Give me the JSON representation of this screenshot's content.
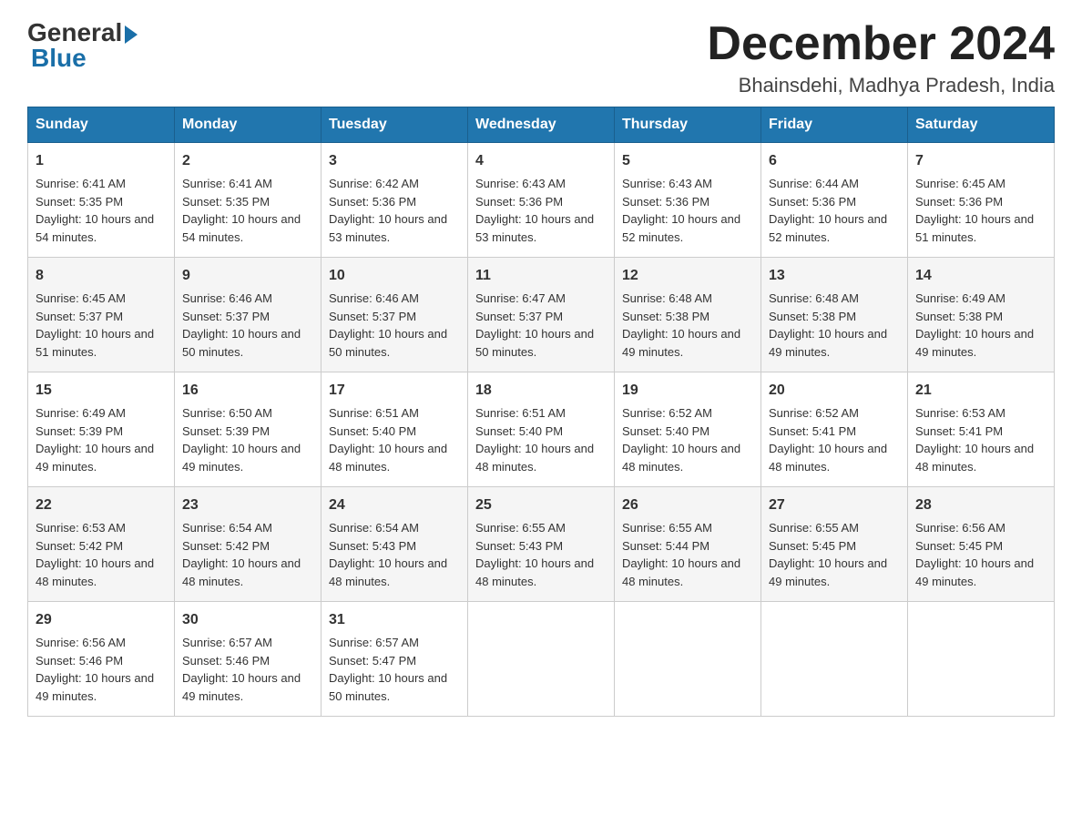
{
  "logo": {
    "general": "General",
    "blue": "Blue"
  },
  "title": "December 2024",
  "location": "Bhainsdehi, Madhya Pradesh, India",
  "headers": [
    "Sunday",
    "Monday",
    "Tuesday",
    "Wednesday",
    "Thursday",
    "Friday",
    "Saturday"
  ],
  "weeks": [
    [
      {
        "day": "1",
        "sunrise": "6:41 AM",
        "sunset": "5:35 PM",
        "daylight": "10 hours and 54 minutes."
      },
      {
        "day": "2",
        "sunrise": "6:41 AM",
        "sunset": "5:35 PM",
        "daylight": "10 hours and 54 minutes."
      },
      {
        "day": "3",
        "sunrise": "6:42 AM",
        "sunset": "5:36 PM",
        "daylight": "10 hours and 53 minutes."
      },
      {
        "day": "4",
        "sunrise": "6:43 AM",
        "sunset": "5:36 PM",
        "daylight": "10 hours and 53 minutes."
      },
      {
        "day": "5",
        "sunrise": "6:43 AM",
        "sunset": "5:36 PM",
        "daylight": "10 hours and 52 minutes."
      },
      {
        "day": "6",
        "sunrise": "6:44 AM",
        "sunset": "5:36 PM",
        "daylight": "10 hours and 52 minutes."
      },
      {
        "day": "7",
        "sunrise": "6:45 AM",
        "sunset": "5:36 PM",
        "daylight": "10 hours and 51 minutes."
      }
    ],
    [
      {
        "day": "8",
        "sunrise": "6:45 AM",
        "sunset": "5:37 PM",
        "daylight": "10 hours and 51 minutes."
      },
      {
        "day": "9",
        "sunrise": "6:46 AM",
        "sunset": "5:37 PM",
        "daylight": "10 hours and 50 minutes."
      },
      {
        "day": "10",
        "sunrise": "6:46 AM",
        "sunset": "5:37 PM",
        "daylight": "10 hours and 50 minutes."
      },
      {
        "day": "11",
        "sunrise": "6:47 AM",
        "sunset": "5:37 PM",
        "daylight": "10 hours and 50 minutes."
      },
      {
        "day": "12",
        "sunrise": "6:48 AM",
        "sunset": "5:38 PM",
        "daylight": "10 hours and 49 minutes."
      },
      {
        "day": "13",
        "sunrise": "6:48 AM",
        "sunset": "5:38 PM",
        "daylight": "10 hours and 49 minutes."
      },
      {
        "day": "14",
        "sunrise": "6:49 AM",
        "sunset": "5:38 PM",
        "daylight": "10 hours and 49 minutes."
      }
    ],
    [
      {
        "day": "15",
        "sunrise": "6:49 AM",
        "sunset": "5:39 PM",
        "daylight": "10 hours and 49 minutes."
      },
      {
        "day": "16",
        "sunrise": "6:50 AM",
        "sunset": "5:39 PM",
        "daylight": "10 hours and 49 minutes."
      },
      {
        "day": "17",
        "sunrise": "6:51 AM",
        "sunset": "5:40 PM",
        "daylight": "10 hours and 48 minutes."
      },
      {
        "day": "18",
        "sunrise": "6:51 AM",
        "sunset": "5:40 PM",
        "daylight": "10 hours and 48 minutes."
      },
      {
        "day": "19",
        "sunrise": "6:52 AM",
        "sunset": "5:40 PM",
        "daylight": "10 hours and 48 minutes."
      },
      {
        "day": "20",
        "sunrise": "6:52 AM",
        "sunset": "5:41 PM",
        "daylight": "10 hours and 48 minutes."
      },
      {
        "day": "21",
        "sunrise": "6:53 AM",
        "sunset": "5:41 PM",
        "daylight": "10 hours and 48 minutes."
      }
    ],
    [
      {
        "day": "22",
        "sunrise": "6:53 AM",
        "sunset": "5:42 PM",
        "daylight": "10 hours and 48 minutes."
      },
      {
        "day": "23",
        "sunrise": "6:54 AM",
        "sunset": "5:42 PM",
        "daylight": "10 hours and 48 minutes."
      },
      {
        "day": "24",
        "sunrise": "6:54 AM",
        "sunset": "5:43 PM",
        "daylight": "10 hours and 48 minutes."
      },
      {
        "day": "25",
        "sunrise": "6:55 AM",
        "sunset": "5:43 PM",
        "daylight": "10 hours and 48 minutes."
      },
      {
        "day": "26",
        "sunrise": "6:55 AM",
        "sunset": "5:44 PM",
        "daylight": "10 hours and 48 minutes."
      },
      {
        "day": "27",
        "sunrise": "6:55 AM",
        "sunset": "5:45 PM",
        "daylight": "10 hours and 49 minutes."
      },
      {
        "day": "28",
        "sunrise": "6:56 AM",
        "sunset": "5:45 PM",
        "daylight": "10 hours and 49 minutes."
      }
    ],
    [
      {
        "day": "29",
        "sunrise": "6:56 AM",
        "sunset": "5:46 PM",
        "daylight": "10 hours and 49 minutes."
      },
      {
        "day": "30",
        "sunrise": "6:57 AM",
        "sunset": "5:46 PM",
        "daylight": "10 hours and 49 minutes."
      },
      {
        "day": "31",
        "sunrise": "6:57 AM",
        "sunset": "5:47 PM",
        "daylight": "10 hours and 50 minutes."
      },
      null,
      null,
      null,
      null
    ]
  ]
}
